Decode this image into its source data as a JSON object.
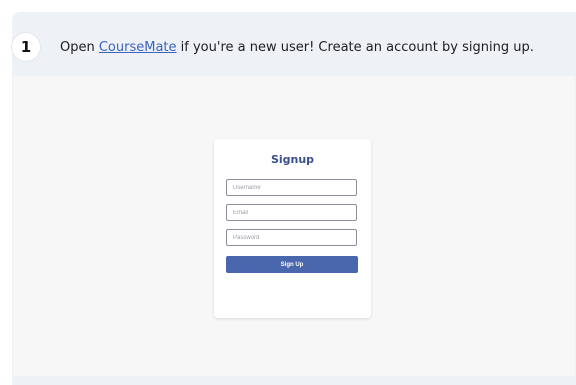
{
  "step": {
    "number": "1",
    "text_before": "Open ",
    "link_text": "CourseMate",
    "text_after": " if you're a new user! Create an account by signing up."
  },
  "signup": {
    "title": "Signup",
    "username_placeholder": "Username",
    "email_placeholder": "Email",
    "password_placeholder": "Password",
    "submit_label": "Sign Up"
  },
  "colors": {
    "panel_bg": "#eef1f6",
    "link": "#3a63c4",
    "title": "#3a4f8c",
    "button": "#4a67ad"
  }
}
